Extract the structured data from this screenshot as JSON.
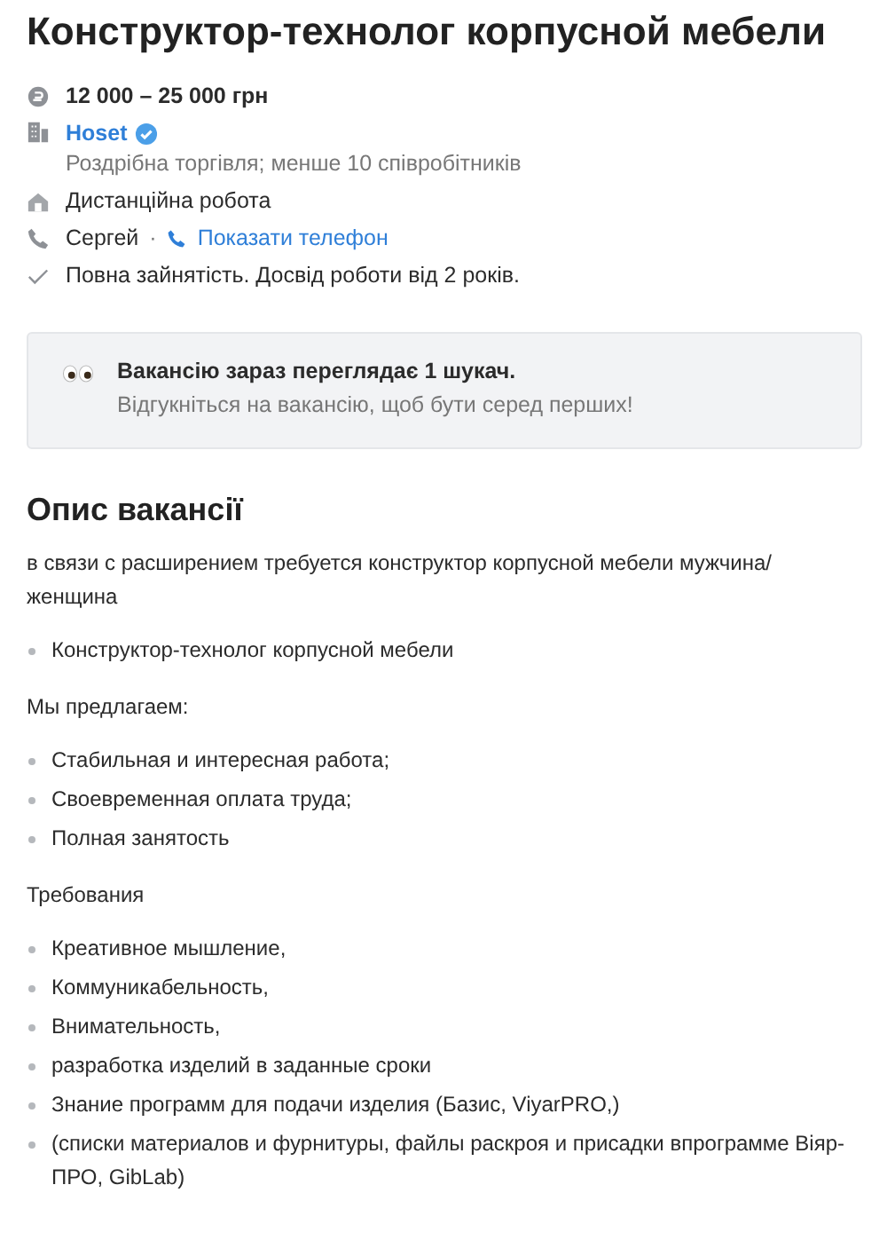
{
  "title": "Конструктор-технолог корпусной мебели",
  "salary": "12 000 – 25 000 грн",
  "company": {
    "name": "Hoset",
    "verified": true,
    "details": "Роздрібна торгівля; менше 10 співробітників"
  },
  "work_mode": "Дистанційна робота",
  "contact": {
    "name": "Сергей",
    "separator": "·",
    "phone_link": "Показати телефон"
  },
  "conditions": "Повна зайнятість. Досвід роботи від 2 років.",
  "notice": {
    "title": "Вакансію зараз переглядає 1 шукач.",
    "text": "Відгукніться на вакансію, щоб бути серед перших!"
  },
  "description": {
    "heading": "Опис вакансії",
    "blocks": [
      {
        "kind": "paragraph",
        "text": "в связи с расширением требуется конструктор корпусной мебели мужчина/ женщина"
      },
      {
        "kind": "list",
        "items": [
          "Конструктор-технолог корпусной мебели"
        ]
      },
      {
        "kind": "paragraph",
        "text": "Мы предлагаем:"
      },
      {
        "kind": "list",
        "items": [
          "Стабильная и интересная работа;",
          "Своевременная оплата труда;",
          "Полная занятость"
        ]
      },
      {
        "kind": "paragraph",
        "text": "Требования"
      },
      {
        "kind": "list",
        "items": [
          "Креативное мышление,",
          "Коммуникабельность,",
          "Внимательность,",
          "разработка изделий в заданные сроки",
          "Знание программ для подачи изделия (Базис, ViyarPRO,)",
          "(списки материалов и фурнитуры, файлы раскроя и присадки впрограмме Віяр-ПРО, GibLab)"
        ]
      }
    ]
  }
}
